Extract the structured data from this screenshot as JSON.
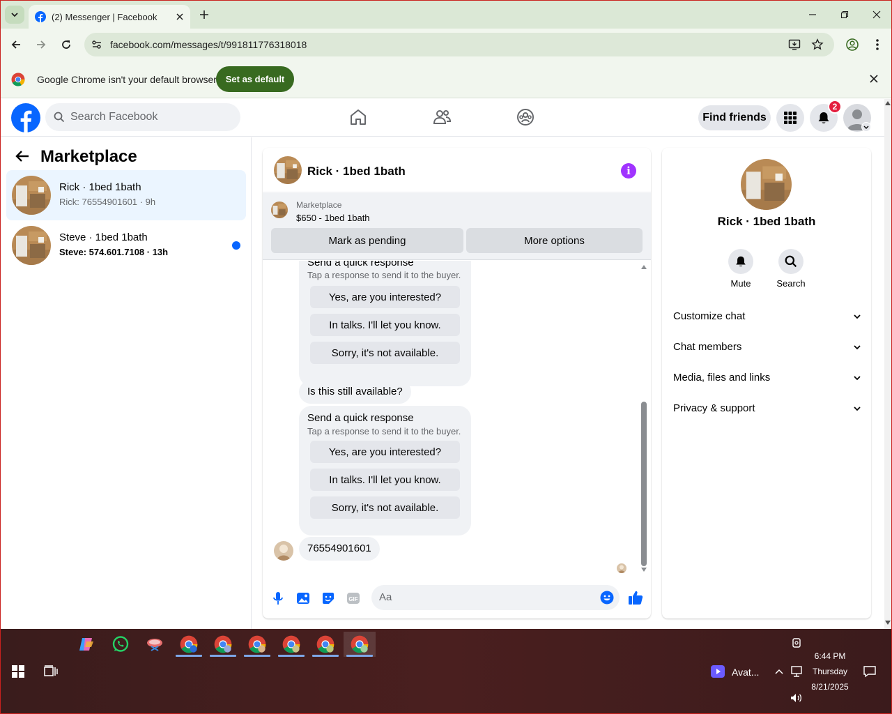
{
  "browser": {
    "tab_title": "(2) Messenger | Facebook",
    "url": "facebook.com/messages/t/991811776318018",
    "infobar_message": "Google Chrome isn't your default browser",
    "set_default_label": "Set as default"
  },
  "facebook": {
    "search_placeholder": "Search Facebook",
    "find_friends_label": "Find friends",
    "notification_count": "2"
  },
  "sidebar": {
    "title": "Marketplace",
    "conversations": [
      {
        "name": "Rick · 1bed 1bath",
        "preview": "Rick: 76554901601 · 9h",
        "selected": true,
        "unread": false
      },
      {
        "name": "Steve · 1bed 1bath",
        "preview": "Steve: 574.601.7108 · 13h",
        "selected": false,
        "unread": true
      }
    ]
  },
  "chat": {
    "title": "Rick · 1bed 1bath",
    "listing_category": "Marketplace",
    "listing_price": "$650 - 1bed 1bath",
    "mark_pending_label": "Mark as pending",
    "more_options_label": "More options",
    "quick_response_title": "Send a quick response",
    "quick_response_subtitle": "Tap a response to send it to the buyer.",
    "quick_options": [
      "Yes, are you interested?",
      "In talks. I'll let you know.",
      "Sorry, it's not available."
    ],
    "buyer_message": "Is this still available?",
    "last_message": "76554901601",
    "input_placeholder": "Aa"
  },
  "details": {
    "name": "Rick · 1bed 1bath",
    "mute_label": "Mute",
    "search_label": "Search",
    "sections": [
      "Customize chat",
      "Chat members",
      "Media, files and links",
      "Privacy & support"
    ]
  },
  "taskbar": {
    "tray_app": "Avat...",
    "time": "6:44 PM",
    "day": "Thursday",
    "date": "8/21/2025"
  },
  "colors": {
    "fb_blue": "#0866ff",
    "chrome_green": "#386a20",
    "info_purple": "#a033ff",
    "badge_red": "#e41e3f"
  }
}
